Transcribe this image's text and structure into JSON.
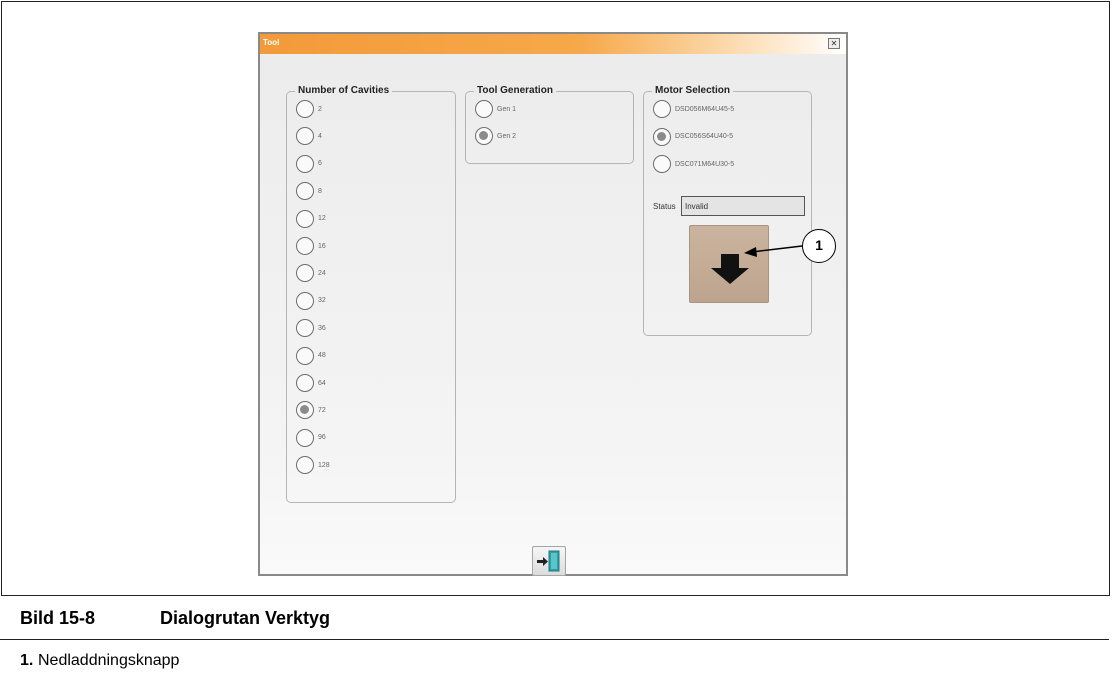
{
  "dialog": {
    "title": "Tool",
    "close_glyph": "✕",
    "groups": {
      "cavities": {
        "legend": "Number of Cavities",
        "options": [
          {
            "label": "2",
            "selected": false
          },
          {
            "label": "4",
            "selected": false
          },
          {
            "label": "6",
            "selected": false
          },
          {
            "label": "8",
            "selected": false
          },
          {
            "label": "12",
            "selected": false
          },
          {
            "label": "16",
            "selected": false
          },
          {
            "label": "24",
            "selected": false
          },
          {
            "label": "32",
            "selected": false
          },
          {
            "label": "36",
            "selected": false
          },
          {
            "label": "48",
            "selected": false
          },
          {
            "label": "64",
            "selected": false
          },
          {
            "label": "72",
            "selected": true
          },
          {
            "label": "96",
            "selected": false
          },
          {
            "label": "128",
            "selected": false
          }
        ]
      },
      "generation": {
        "legend": "Tool Generation",
        "options": [
          {
            "label": "Gen 1",
            "selected": false
          },
          {
            "label": "Gen 2",
            "selected": true
          }
        ]
      },
      "motor": {
        "legend": "Motor Selection",
        "options": [
          {
            "label": "DSD056M64U45-5",
            "selected": false
          },
          {
            "label": "DSC056S64U40-5",
            "selected": true
          },
          {
            "label": "DSC071M64U30-5",
            "selected": false
          }
        ],
        "status_label": "Status",
        "status_value": "Invalid"
      }
    },
    "download_icon": "arrow-down-icon",
    "exit_icon": "exit-door-icon"
  },
  "callout": {
    "number": "1"
  },
  "caption": {
    "figure_number": "Bild 15-8",
    "figure_title": "Dialogrutan Verktyg",
    "legend": [
      {
        "number": "1.",
        "text": "Nedladdningsknapp"
      }
    ]
  },
  "colors": {
    "title_bar": "#f39a3a",
    "download_button": "#c4ad97",
    "exit_door": "#2aa0a8"
  }
}
